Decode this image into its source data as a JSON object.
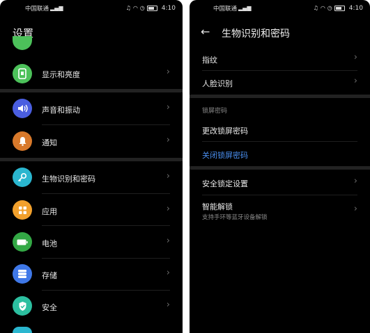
{
  "left": {
    "status": {
      "carrier": "中国联通",
      "time": "4:10"
    },
    "title": "设置",
    "items": [
      {
        "label": "显示和亮度",
        "icon": "display-brightness-icon",
        "color": "#4cc15a"
      },
      {
        "label": "声音和振动",
        "icon": "sound-vibration-icon",
        "color": "#4a5ee0"
      },
      {
        "label": "通知",
        "icon": "bell-icon",
        "color": "#d8792b"
      },
      {
        "label": "生物识别和密码",
        "icon": "key-icon",
        "color": "#2ab6cf"
      },
      {
        "label": "应用",
        "icon": "apps-grid-icon",
        "color": "#f2a02c"
      },
      {
        "label": "电池",
        "icon": "battery-icon",
        "color": "#33a845"
      },
      {
        "label": "存储",
        "icon": "storage-icon",
        "color": "#3f78e8"
      },
      {
        "label": "安全",
        "icon": "shield-icon",
        "color": "#2cbfa0"
      }
    ],
    "partial_top_icon_color": "#4cc15a",
    "partial_bottom_icon_color": "#2ab6cf"
  },
  "right": {
    "status": {
      "carrier": "中国联通",
      "time": "4:10"
    },
    "title": "生物识别和密码",
    "items_top": [
      {
        "label": "指纹"
      },
      {
        "label": "人脸识别"
      }
    ],
    "lock_section": {
      "header": "锁屏密码",
      "change": "更改锁屏密码",
      "disable": "关闭锁屏密码"
    },
    "items_bottom": [
      {
        "label": "安全锁定设置"
      },
      {
        "label": "智能解锁",
        "sub": "支持手环等蓝牙设备解锁"
      }
    ],
    "accent_color": "#4a8ff0"
  }
}
